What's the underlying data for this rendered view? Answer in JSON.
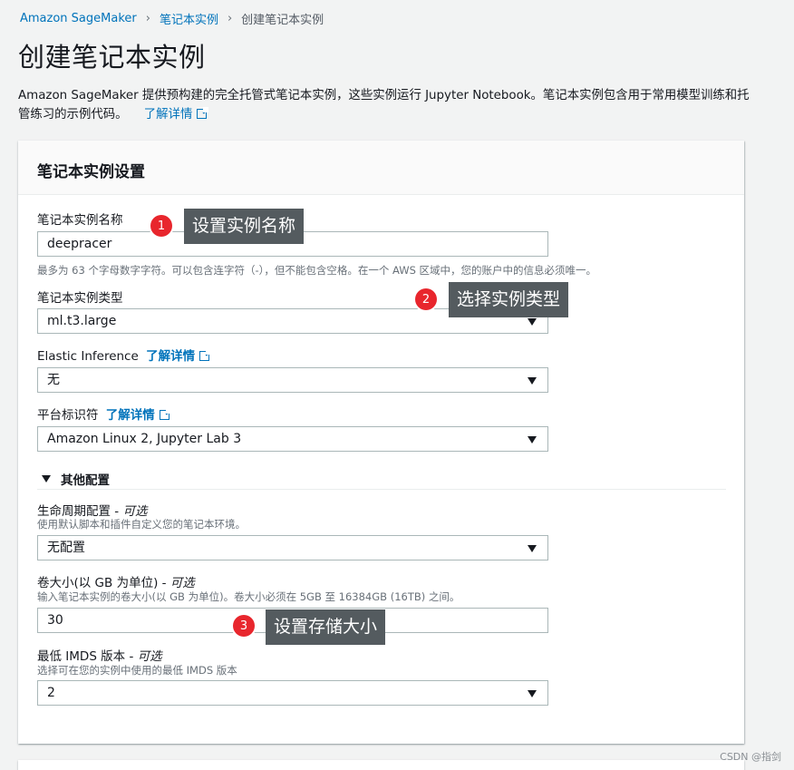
{
  "breadcrumb": {
    "root": "Amazon SageMaker",
    "parent": "笔记本实例",
    "current": "创建笔记本实例"
  },
  "page": {
    "title": "创建笔记本实例",
    "description": "Amazon SageMaker 提供预构建的完全托管式笔记本实例，这些实例运行 Jupyter Notebook。笔记本实例包含用于常用模型训练和托管练习的示例代码。",
    "learn_more": "了解详情"
  },
  "card": {
    "title": "笔记本实例设置"
  },
  "fields": {
    "name": {
      "label": "笔记本实例名称",
      "value": "deepracer",
      "hint": "最多为 63 个字母数字字符。可以包含连字符（-），但不能包含空格。在一个 AWS 区域中，您的账户中的信息必须唯一。"
    },
    "type": {
      "label": "笔记本实例类型",
      "value": "ml.t3.large"
    },
    "elastic": {
      "label": "Elastic Inference",
      "learn_more": "了解详情",
      "value": "无"
    },
    "platform": {
      "label": "平台标识符",
      "learn_more": "了解详情",
      "value": "Amazon Linux 2, Jupyter Lab 3"
    },
    "additional": {
      "label": "其他配置"
    },
    "lifecycle": {
      "label": "生命周期配置 - ",
      "optional": "可选",
      "hint": "使用默认脚本和插件自定义您的笔记本环境。",
      "value": "无配置"
    },
    "volume": {
      "label": "卷大小(以 GB 为单位) - ",
      "optional": "可选",
      "hint": "输入笔记本实例的卷大小(以 GB 为单位)。卷大小必须在 5GB 至 16384GB (16TB) 之间。",
      "value": "30"
    },
    "imds": {
      "label": "最低 IMDS 版本 - ",
      "optional": "可选",
      "hint": "选择可在您的实例中使用的最低 IMDS 版本",
      "value": "2"
    }
  },
  "annotations": [
    {
      "number": "1",
      "text": "设置实例名称"
    },
    {
      "number": "2",
      "text": "选择实例类型"
    },
    {
      "number": "3",
      "text": "设置存储大小"
    }
  ],
  "watermark": "CSDN @指剑",
  "colors": {
    "link": "#0073bb",
    "badge": "#e8262d",
    "tooltip": "#545b5f",
    "background": "#f2f3f3"
  }
}
